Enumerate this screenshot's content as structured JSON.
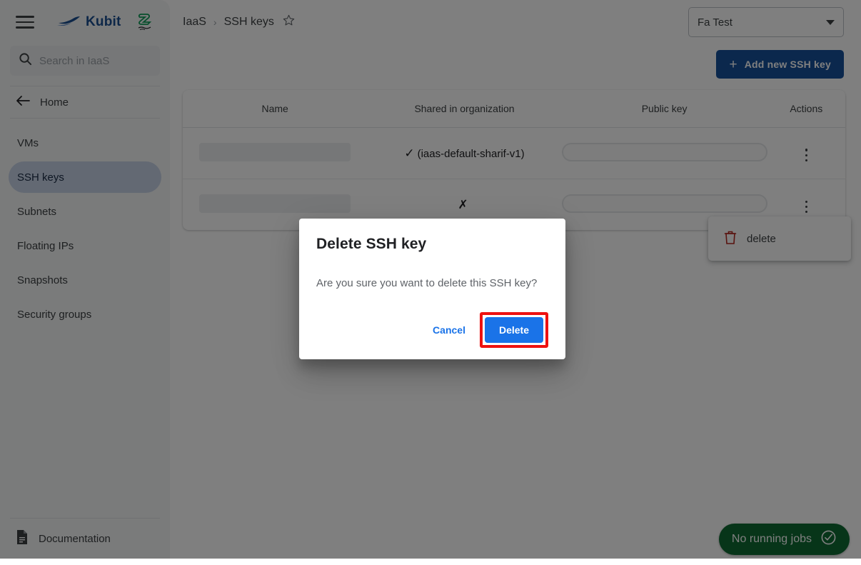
{
  "brand": {
    "name": "Kubit",
    "logo_icon": "speed-boat-icon",
    "partner_logo_icon": "partner-s-logo-icon",
    "accent": "#1a4f91"
  },
  "sidebar": {
    "menu_icon": "hamburger-menu-icon",
    "search": {
      "icon": "search-icon",
      "placeholder": "Search in IaaS",
      "value": ""
    },
    "home": {
      "label": "Home",
      "icon": "arrow-left-icon"
    },
    "items": [
      {
        "label": "VMs",
        "active": false
      },
      {
        "label": "SSH keys",
        "active": true
      },
      {
        "label": "Subnets",
        "active": false
      },
      {
        "label": "Floating IPs",
        "active": false
      },
      {
        "label": "Snapshots",
        "active": false
      },
      {
        "label": "Security groups",
        "active": false
      }
    ],
    "footer": {
      "label": "Documentation",
      "icon": "document-icon"
    },
    "active_bg": "#c6d3e6"
  },
  "header": {
    "breadcrumb": [
      "IaaS",
      "SSH keys"
    ],
    "separator": "›",
    "favorite_icon": "star-outline-icon",
    "org_select": {
      "value": "Fa Test",
      "icon": "chevron-down-icon"
    }
  },
  "toolbar": {
    "add_label": "Add new SSH key",
    "add_icon": "plus-icon",
    "add_color": "#17509a"
  },
  "table": {
    "columns": [
      "Name",
      "Shared in organization",
      "Public key",
      "Actions"
    ],
    "rows": [
      {
        "name": "",
        "name_placeholder": true,
        "shared_mark": "✓",
        "shared_label": "(iaas-default-sharif-v1)",
        "public_key_placeholder": true,
        "actions_icon": "kebab-menu-icon"
      },
      {
        "name": "",
        "name_placeholder": true,
        "shared_mark": "✗",
        "shared_label": "",
        "public_key_placeholder": true,
        "actions_icon": "kebab-menu-icon"
      }
    ]
  },
  "context_menu": {
    "items": [
      {
        "label": "delete",
        "icon": "trash-icon",
        "color": "#b3261e"
      }
    ]
  },
  "status_chip": {
    "label": "No running jobs",
    "icon": "check-circle-icon",
    "color": "#0f6b33"
  },
  "modal": {
    "title": "Delete SSH key",
    "message": "Are you sure you want to delete this SSH key?",
    "cancel_label": "Cancel",
    "confirm_label": "Delete",
    "confirm_color": "#1a73e8",
    "highlight_color": "#ee1111"
  }
}
